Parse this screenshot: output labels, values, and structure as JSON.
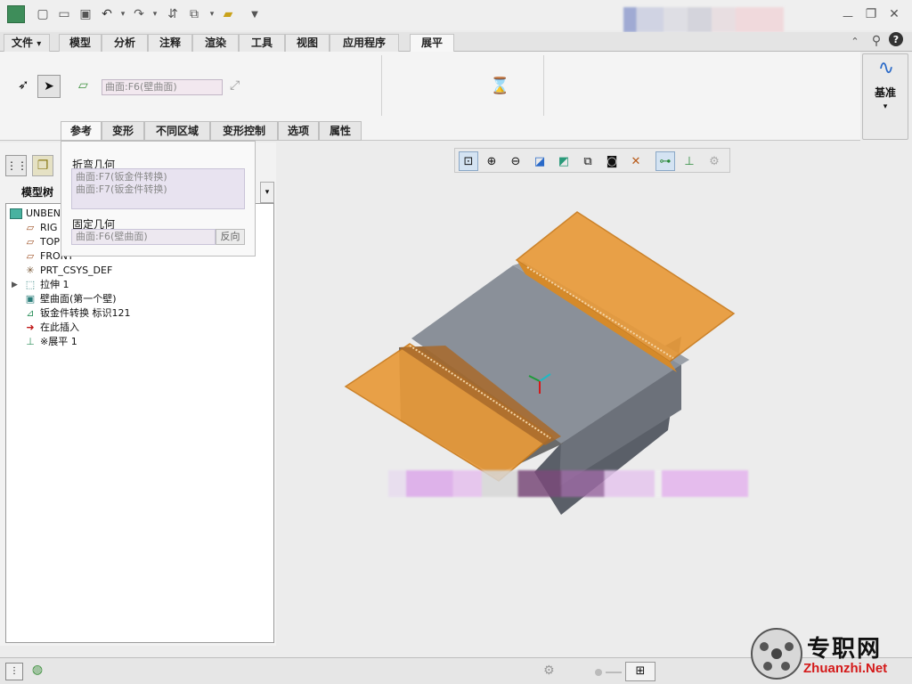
{
  "quick_access": {
    "icons": [
      "app-icon",
      "new-icon",
      "open-icon",
      "save-icon",
      "undo-icon",
      "redo-icon",
      "regenerate-icon",
      "windows-icon",
      "close-window-icon",
      "customize-icon"
    ]
  },
  "tabs": [
    {
      "label": "文件",
      "dropdown": "▾"
    },
    {
      "label": "模型"
    },
    {
      "label": "分析"
    },
    {
      "label": "注释"
    },
    {
      "label": "渲染"
    },
    {
      "label": "工具"
    },
    {
      "label": "视图"
    },
    {
      "label": "应用程序"
    },
    {
      "label": "展平",
      "active": true
    }
  ],
  "ribbon": {
    "collector_value": "曲面:F6(壁曲面)",
    "datum_label": "基准"
  },
  "popup": {
    "tabs": [
      "参考",
      "变形",
      "不同区域",
      "变形控制",
      "选项",
      "属性"
    ],
    "bend_geom_label": "折弯几何",
    "bend_geom_items": [
      "曲面:F7(钣金件转换)",
      "曲面:F7(钣金件转换)"
    ],
    "fixed_geom_label": "固定几何",
    "fixed_geom_value": "曲面:F6(壁曲面)",
    "flip_button": "反向"
  },
  "model_tree": {
    "header": "模型树",
    "items": [
      {
        "label": "UNBEND_",
        "icon": "part-icon"
      },
      {
        "label": "RIG",
        "icon": "datum-plane-icon"
      },
      {
        "label": "TOP",
        "icon": "datum-plane-icon"
      },
      {
        "label": "FRONT",
        "icon": "datum-plane-icon"
      },
      {
        "label": "PRT_CSYS_DEF",
        "icon": "csys-icon"
      },
      {
        "label": "拉伸 1",
        "icon": "extrude-icon",
        "expandable": true
      },
      {
        "label": "壁曲面(第一个壁)",
        "icon": "wall-surface-icon"
      },
      {
        "label": "钣金件转换 标识121",
        "icon": "sheetmetal-convert-icon"
      },
      {
        "label": "在此插入",
        "icon": "insert-here-icon"
      },
      {
        "label": "※展平 1",
        "icon": "flatten-icon"
      }
    ]
  },
  "colors": {
    "accent_orange": "#e89a3a",
    "model_gray": "#8a9099",
    "tree_bg": "#ffffff"
  },
  "watermark": {
    "logo_text": "专职网",
    "url": "Zhuanzhi.Net"
  }
}
